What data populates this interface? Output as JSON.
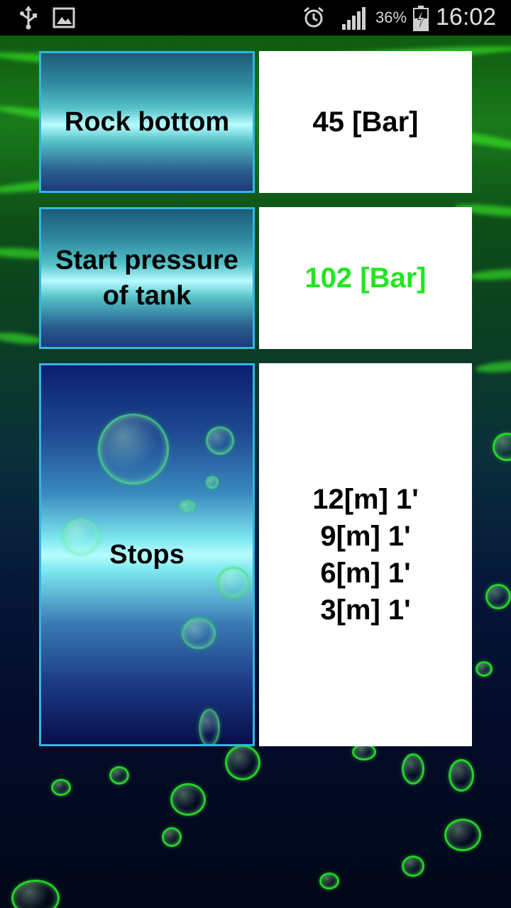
{
  "status_bar": {
    "time": "16:02",
    "battery_percent": "36%",
    "icons": [
      "usb-icon",
      "image-icon",
      "alarm-icon",
      "signal-icon",
      "battery-charging-icon"
    ]
  },
  "rows": [
    {
      "label": "Rock bottom",
      "value": "45 [Bar]"
    },
    {
      "label_line1": "Start pressure",
      "label_line2": "of tank",
      "value": "102 [Bar]",
      "value_color": "#22e61f"
    },
    {
      "label": "Stops",
      "stops": [
        "12[m] 1'",
        "9[m] 1'",
        "6[m] 1'",
        "3[m] 1'"
      ]
    }
  ],
  "colors": {
    "cell_border": "#33b5e5",
    "highlight_value": "#22e61f"
  }
}
